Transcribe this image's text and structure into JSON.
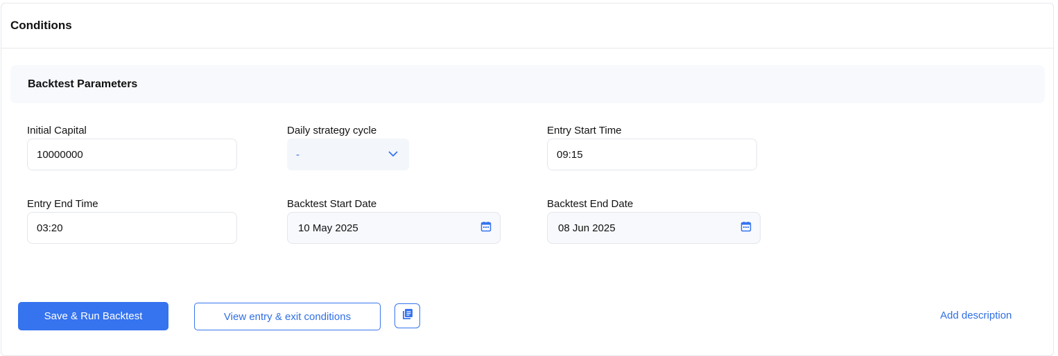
{
  "panel": {
    "title": "Conditions"
  },
  "section": {
    "title": "Backtest Parameters"
  },
  "fields": {
    "initial_capital": {
      "label": "Initial Capital",
      "value": "10000000"
    },
    "daily_cycle": {
      "label": "Daily strategy cycle",
      "value": "-"
    },
    "entry_start": {
      "label": "Entry Start Time",
      "value": "09:15"
    },
    "entry_end": {
      "label": "Entry End Time",
      "value": "03:20"
    },
    "backtest_start": {
      "label": "Backtest Start Date",
      "value": "10 May 2025"
    },
    "backtest_end": {
      "label": "Backtest End Date",
      "value": "08 Jun 2025"
    }
  },
  "actions": {
    "save_run": "Save & Run Backtest",
    "view_conditions": "View entry & exit conditions",
    "add_description": "Add description"
  },
  "icons": {
    "select_chevron": "chevron-down-icon",
    "date_picker": "calendar-icon",
    "copy": "copy-icon"
  },
  "colors": {
    "accent": "#3573ef",
    "accent_text": "#2f6fe4",
    "section_bg": "#f7f9fc"
  }
}
